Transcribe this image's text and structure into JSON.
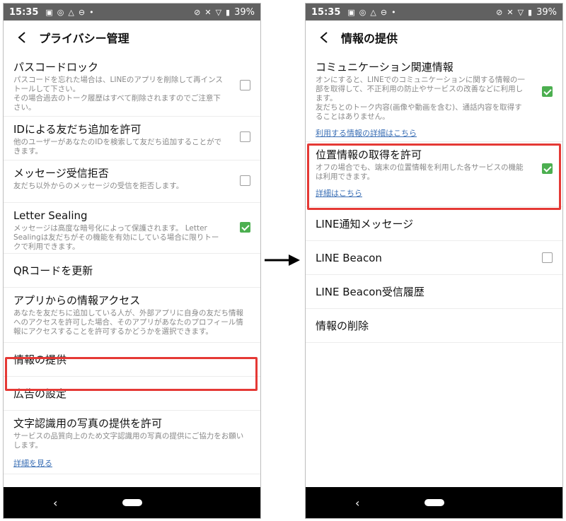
{
  "status": {
    "time": "15:35",
    "battery": "39%"
  },
  "left": {
    "title": "プライバシー管理",
    "items": [
      {
        "title": "パスコードロック",
        "desc": "パスコードを忘れた場合は、LINEのアプリを削除して再インストールして下さい。\nその場合過去のトーク履歴はすべて削除されますのでご注意下さい。",
        "checked": false
      },
      {
        "title": "IDによる友だち追加を許可",
        "desc": "他のユーザーがあなたのIDを検索して友だち追加することができます。",
        "checked": false
      },
      {
        "title": "メッセージ受信拒否",
        "desc": "友だち以外からのメッセージの受信を拒否します。",
        "checked": false
      },
      {
        "title": "Letter Sealing",
        "desc": "メッセージは高度な暗号化によって保護されます。 Letter Sealingは友だちがその機能を有効にしている場合に限りトークで利用できます。",
        "checked": true
      },
      {
        "title": "QRコードを更新"
      },
      {
        "title": "アプリからの情報アクセス",
        "desc": "あなたを友だちに追加している人が、外部アプリに自身の友だち情報へのアクセスを許可した場合、そのアプリがあなたのプロフィール情報にアクセスすることを許可するかどうかを選択できます。"
      },
      {
        "title": "情報の提供"
      },
      {
        "title": "広告の設定"
      },
      {
        "title": "文字認識用の写真の提供を許可",
        "desc": "サービスの品質向上のため文字認識用の写真の提供にご協力をお願いします。",
        "link": "詳細を見る"
      }
    ]
  },
  "right": {
    "title": "情報の提供",
    "items": [
      {
        "title": "コミュニケーション関連情報",
        "desc": "オンにすると、LINEでのコミュニケーションに関する情報の一部を取得して、不正利用の防止やサービスの改善などに利用します。\n友だちとのトーク内容(画像や動画を含む)、通話内容を取得することはありません。",
        "link": "利用する情報の詳細はこちら",
        "checked": true
      },
      {
        "title": "位置情報の取得を許可",
        "desc": "オフの場合でも、端末の位置情報を利用した各サービスの機能は利用できます。",
        "link": "詳細はこちら",
        "checked": true
      },
      {
        "title": "LINE通知メッセージ"
      },
      {
        "title": "LINE Beacon",
        "checked": false
      },
      {
        "title": "LINE Beacon受信履歴"
      },
      {
        "title": "情報の削除"
      }
    ]
  },
  "colors": {
    "highlight": "#e53935",
    "checkbox_on": "#4caf50",
    "link": "#3b6fb5"
  },
  "icons": [
    "back-icon",
    "image-icon",
    "instagram-icon",
    "drive-icon",
    "dnd-icon",
    "wifi-icon",
    "battery-icon",
    "arrow-right-icon"
  ]
}
